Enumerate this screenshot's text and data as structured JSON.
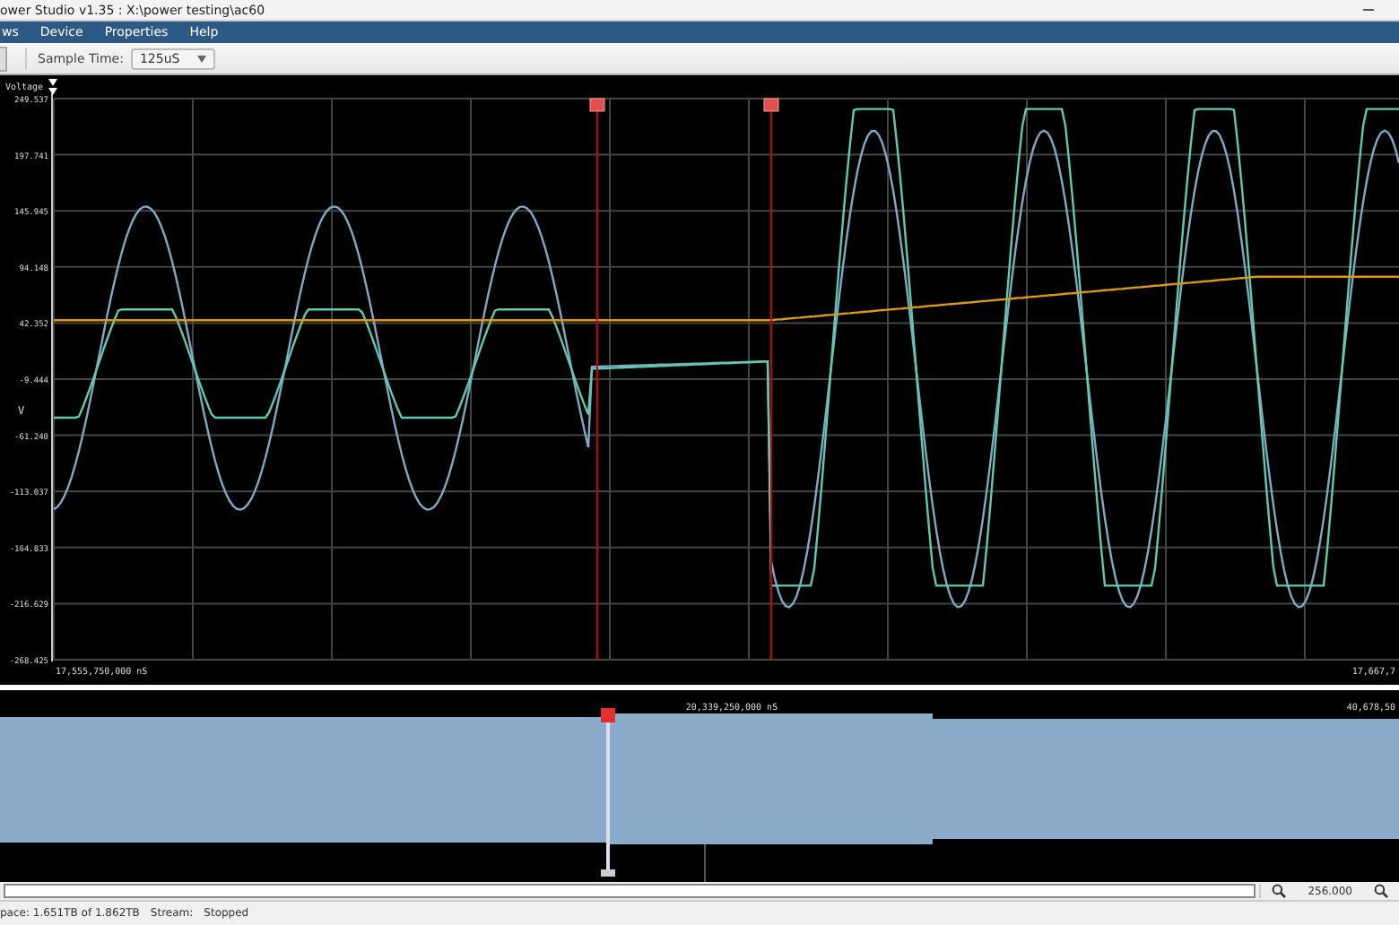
{
  "window": {
    "title": "ower Studio v1.35 : X:\\power testing\\ac60"
  },
  "menu": [
    {
      "label": "ws"
    },
    {
      "label": "Device"
    },
    {
      "label": "Properties"
    },
    {
      "label": "Help"
    }
  ],
  "toolbar": {
    "label": "Sample Time:",
    "value": "125uS"
  },
  "chart": {
    "title": "Voltage",
    "unit": "V",
    "yticks": [
      "249.537",
      "197.741",
      "145.945",
      "94.148",
      "42.352",
      "-9.444",
      "-61.240",
      "-113.037",
      "-164.833",
      "-216.629",
      "-268.425"
    ],
    "x_start": "17,555,750,000 nS",
    "x_end": "17,667,7"
  },
  "overview": {
    "center_label": "20,339,250,000 nS",
    "end_label": "40,678,50"
  },
  "zoom": {
    "value": "256.000"
  },
  "status": {
    "storage": "pace: 1.651TB of 1.862TB",
    "stream_label": "Stream:",
    "stream_value": "Stopped"
  }
}
